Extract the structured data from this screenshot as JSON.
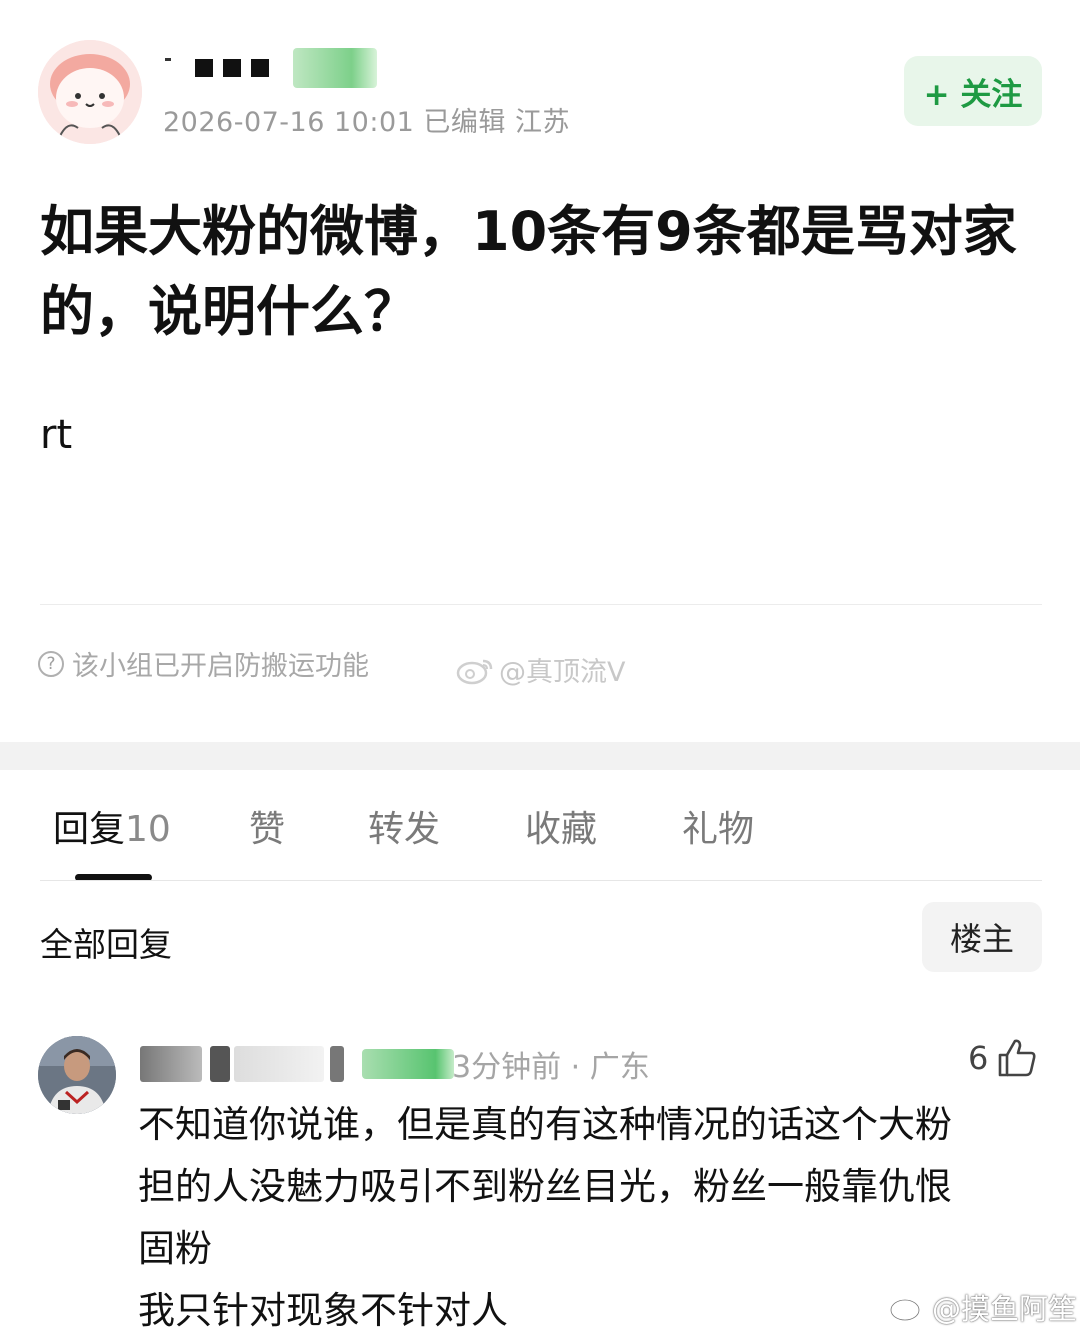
{
  "post": {
    "author_meta": "2026-07-16 10:01  已编辑  江苏",
    "follow_label": "+ 关注",
    "title_line1": "如果大粉的微博，10条有9条都是骂对家",
    "title_line2": "的，说明什么？",
    "body": "rt",
    "notice": "该小组已开启防搬运功能",
    "watermark": "@真顶流V"
  },
  "tabs": [
    {
      "label": "回复",
      "count": "10"
    },
    {
      "label": "赞"
    },
    {
      "label": "转发"
    },
    {
      "label": "收藏"
    },
    {
      "label": "礼物"
    }
  ],
  "replies_section": {
    "heading": "全部回复",
    "filter_label": "楼主"
  },
  "reply": {
    "meta": "3分钟前 · 广东",
    "likes": "6",
    "lines": [
      "不知道你说谁，但是真的有这种情况的话这个大粉",
      "担的人没魅力吸引不到粉丝目光，粉丝一般靠仇恨",
      "固粉",
      "我只针对现象不针对人"
    ]
  },
  "footer_watermark": "@摸鱼阿笙",
  "colors": {
    "accent_green": "#1e9a43",
    "follow_bg": "#e8f6ea",
    "meta_gray": "#9a9a9a"
  },
  "icons": [
    "avatar-op",
    "help-circle-icon",
    "weibo-logo-icon",
    "thumbs-up-icon",
    "avatar-reply"
  ]
}
